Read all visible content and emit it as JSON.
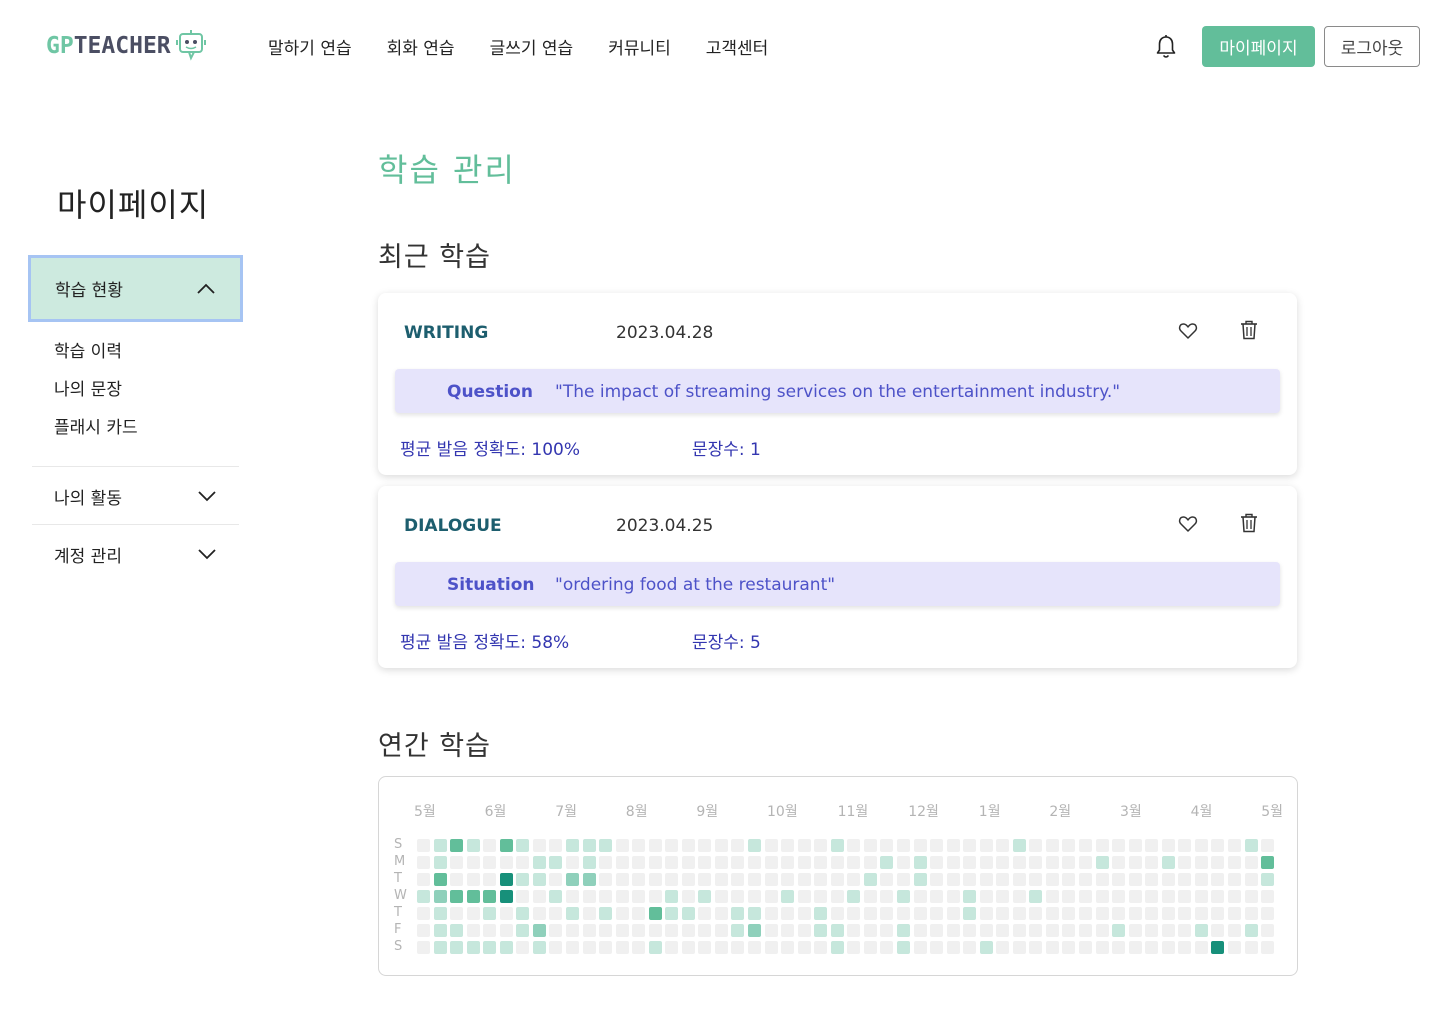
{
  "header": {
    "logo_gp": "GP",
    "logo_teacher": "TEACHER",
    "nav": [
      "말하기 연습",
      "회화 연습",
      "글쓰기 연습",
      "커뮤니티",
      "고객센터"
    ],
    "mypage_button": "마이페이지",
    "logout_button": "로그아웃"
  },
  "sidebar": {
    "title": "마이페이지",
    "active_group": "학습 현황",
    "sub_items": [
      "학습 이력",
      "나의 문장",
      "플래시 카드"
    ],
    "groups": [
      "나의 활동",
      "계정 관리"
    ]
  },
  "main": {
    "title": "학습 관리",
    "recent_title": "최근 학습",
    "cards": [
      {
        "type": "WRITING",
        "date": "2023.04.28",
        "prompt_label": "Question",
        "prompt_text": "\"The impact of streaming services on the entertainment industry.\"",
        "accuracy": "평균 발음 정확도: 100%",
        "sentences": "문장수: 1"
      },
      {
        "type": "DIALOGUE",
        "date": "2023.04.25",
        "prompt_label": "Situation",
        "prompt_text": "\"ordering food at the restaurant\"",
        "accuracy": "평균 발음 정확도: 58%",
        "sentences": "문장수: 5"
      }
    ],
    "yearly_title": "연간 학습"
  },
  "heatmap": {
    "months": [
      "5월",
      "6월",
      "7월",
      "8월",
      "9월",
      "10월",
      "11월",
      "12월",
      "1월",
      "2월",
      "3월",
      "4월",
      "5월"
    ],
    "days": [
      "S",
      "M",
      "T",
      "W",
      "T",
      "F",
      "S"
    ],
    "colors": [
      "#f0f0f0",
      "#c6e7dc",
      "#8fd0bb",
      "#62be9a",
      "#17907a"
    ],
    "levels": [
      [
        0,
        0,
        0,
        1,
        0,
        0,
        0
      ],
      [
        1,
        1,
        3,
        2,
        1,
        1,
        1
      ],
      [
        3,
        0,
        0,
        3,
        0,
        1,
        1
      ],
      [
        1,
        0,
        0,
        3,
        0,
        0,
        1
      ],
      [
        0,
        0,
        0,
        3,
        1,
        0,
        1
      ],
      [
        3,
        0,
        4,
        4,
        0,
        0,
        1
      ],
      [
        1,
        0,
        1,
        0,
        1,
        1,
        0
      ],
      [
        0,
        1,
        1,
        0,
        0,
        2,
        1
      ],
      [
        0,
        1,
        0,
        1,
        0,
        0,
        0
      ],
      [
        1,
        0,
        2,
        0,
        1,
        0,
        0
      ],
      [
        1,
        1,
        2,
        0,
        0,
        0,
        0
      ],
      [
        1,
        0,
        0,
        0,
        1,
        0,
        0
      ],
      [
        0,
        0,
        0,
        0,
        0,
        0,
        0
      ],
      [
        0,
        0,
        0,
        0,
        0,
        0,
        0
      ],
      [
        0,
        0,
        0,
        0,
        3,
        0,
        1
      ],
      [
        0,
        0,
        0,
        1,
        1,
        0,
        0
      ],
      [
        0,
        0,
        0,
        0,
        1,
        0,
        0
      ],
      [
        0,
        0,
        0,
        1,
        0,
        0,
        0
      ],
      [
        0,
        0,
        0,
        0,
        0,
        0,
        0
      ],
      [
        0,
        0,
        0,
        0,
        1,
        1,
        0
      ],
      [
        1,
        0,
        0,
        0,
        1,
        2,
        0
      ],
      [
        0,
        0,
        0,
        0,
        0,
        0,
        0
      ],
      [
        0,
        0,
        0,
        1,
        0,
        0,
        0
      ],
      [
        0,
        0,
        0,
        0,
        0,
        0,
        0
      ],
      [
        0,
        0,
        0,
        0,
        1,
        1,
        0
      ],
      [
        1,
        0,
        0,
        0,
        0,
        1,
        1
      ],
      [
        0,
        0,
        0,
        1,
        0,
        0,
        0
      ],
      [
        0,
        0,
        1,
        0,
        0,
        0,
        0
      ],
      [
        0,
        1,
        0,
        0,
        0,
        0,
        0
      ],
      [
        0,
        0,
        0,
        1,
        0,
        1,
        1
      ],
      [
        0,
        1,
        1,
        0,
        0,
        0,
        0
      ],
      [
        0,
        0,
        0,
        0,
        0,
        0,
        0
      ],
      [
        0,
        0,
        0,
        0,
        0,
        0,
        0
      ],
      [
        0,
        0,
        0,
        1,
        1,
        0,
        0
      ],
      [
        0,
        0,
        0,
        0,
        0,
        0,
        1
      ],
      [
        0,
        0,
        0,
        0,
        0,
        0,
        0
      ],
      [
        1,
        0,
        0,
        0,
        0,
        0,
        0
      ],
      [
        0,
        0,
        0,
        1,
        0,
        0,
        0
      ],
      [
        0,
        0,
        0,
        0,
        0,
        0,
        0
      ],
      [
        0,
        0,
        0,
        0,
        0,
        0,
        0
      ],
      [
        0,
        0,
        0,
        0,
        0,
        0,
        0
      ],
      [
        0,
        1,
        0,
        0,
        0,
        0,
        0
      ],
      [
        0,
        0,
        0,
        0,
        0,
        1,
        0
      ],
      [
        0,
        0,
        0,
        0,
        0,
        0,
        0
      ],
      [
        0,
        0,
        0,
        0,
        0,
        0,
        0
      ],
      [
        0,
        1,
        0,
        0,
        0,
        0,
        0
      ],
      [
        0,
        0,
        0,
        0,
        0,
        0,
        0
      ],
      [
        0,
        0,
        0,
        0,
        0,
        1,
        0
      ],
      [
        0,
        0,
        0,
        0,
        0,
        0,
        4
      ],
      [
        0,
        0,
        0,
        0,
        0,
        0,
        0
      ],
      [
        1,
        0,
        0,
        0,
        0,
        1,
        0
      ],
      [
        0,
        3,
        1,
        0,
        0,
        0,
        0
      ]
    ]
  }
}
